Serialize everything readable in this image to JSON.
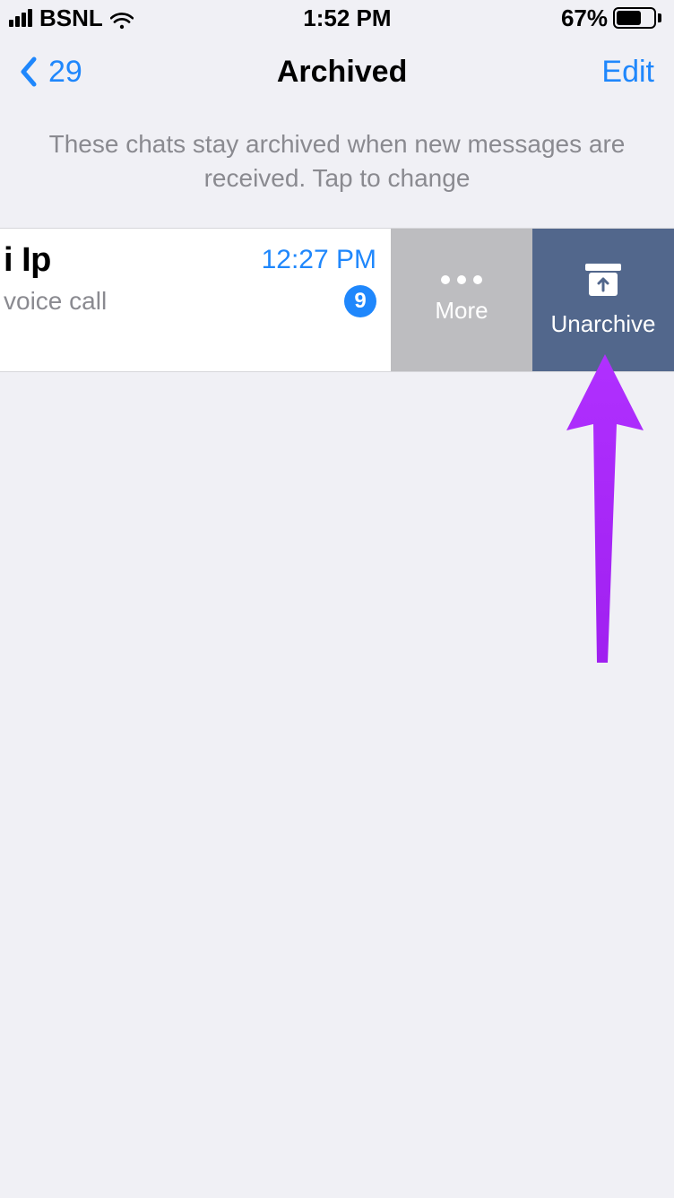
{
  "status": {
    "carrier": "BSNL",
    "time": "1:52 PM",
    "battery_pct": "67%",
    "battery_fill_pct": 67
  },
  "nav": {
    "back_count": "29",
    "title": "Archived",
    "edit": "Edit"
  },
  "info_text": "These chats stay archived when new messages are received. Tap to change",
  "chat_row": {
    "name": "i Ip",
    "time": "12:27 PM",
    "subtitle": "voice call",
    "unread": "9"
  },
  "actions": {
    "more": "More",
    "unarchive": "Unarchive"
  },
  "colors": {
    "accent": "#1f87fc",
    "more_bg": "#bdbdc0",
    "unarchive_bg": "#52678c",
    "annotation": "#a020f0"
  }
}
